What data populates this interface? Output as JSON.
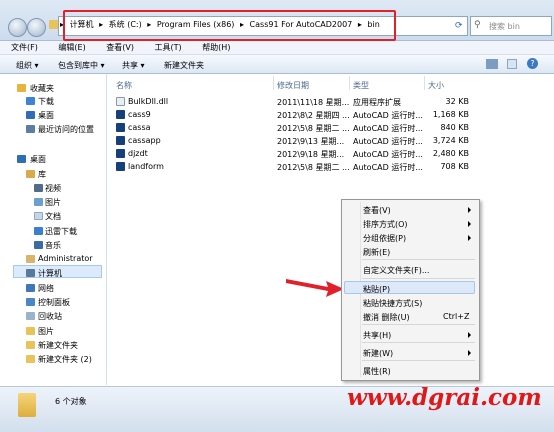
{
  "address": {
    "segments": [
      "计算机",
      "系统 (C:)",
      "Program Files (x86)",
      "Cass91 For AutoCAD2007",
      "bin"
    ],
    "separator": "▸",
    "search_placeholder": "搜索 bin"
  },
  "menubar": [
    "文件(F)",
    "编辑(E)",
    "查看(V)",
    "工具(T)",
    "帮助(H)"
  ],
  "toolbar": {
    "organize": "组织 ▾",
    "include": "包含到库中 ▾",
    "share": "共享 ▾",
    "new_folder": "新建文件夹"
  },
  "nav": {
    "favorites": "收藏夹",
    "downloads": "下载",
    "desktop": "桌面",
    "recent": "最近访问的位置",
    "desktop2": "桌面",
    "libraries": "库",
    "videos": "视频",
    "pictures": "图片",
    "documents": "文档",
    "thunder": "迅雷下载",
    "music": "音乐",
    "admin": "Administrator",
    "computer": "计算机",
    "network": "网络",
    "control_panel": "控制面板",
    "recycle": "回收站",
    "pictures2": "图片",
    "new_folder": "新建文件夹",
    "new_folder2": "新建文件夹 (2)"
  },
  "columns": {
    "name": "名称",
    "date": "修改日期",
    "type": "类型",
    "size": "大小"
  },
  "files": [
    {
      "name": "BulkDll.dll",
      "date": "2011\\11\\18 星期...",
      "type": "应用程序扩展",
      "size": "32 KB"
    },
    {
      "name": "cass9",
      "date": "2012\\8\\2 星期四 ...",
      "type": "AutoCAD 运行时...",
      "size": "1,168 KB"
    },
    {
      "name": "cassa",
      "date": "2012\\5\\8 星期二 ...",
      "type": "AutoCAD 运行时...",
      "size": "840 KB"
    },
    {
      "name": "cassapp",
      "date": "2012\\9\\13 星期...",
      "type": "AutoCAD 运行时...",
      "size": "3,724 KB"
    },
    {
      "name": "djzdt",
      "date": "2012\\9\\18 星期...",
      "type": "AutoCAD 运行时...",
      "size": "2,480 KB"
    },
    {
      "name": "landform",
      "date": "2012\\5\\8 星期二 ...",
      "type": "AutoCAD 运行时...",
      "size": "708 KB"
    }
  ],
  "status": {
    "count": "6 个对象"
  },
  "context_menu": {
    "view": "查看(V)",
    "sort": "排序方式(O)",
    "group": "分组依据(P)",
    "refresh": "刷新(E)",
    "customize": "自定义文件夹(F)...",
    "paste": "粘贴(P)",
    "paste_shortcut": "粘贴快捷方式(S)",
    "undo": "撤消 删除(U)",
    "undo_shortcut": "Ctrl+Z",
    "share": "共享(H)",
    "new": "新建(W)",
    "properties": "属性(R)"
  },
  "watermark": "www.dgrai.com",
  "colors": {
    "highlight_red": "#e0202a",
    "watermark": "#e01818",
    "selection": "#dde9f8"
  }
}
